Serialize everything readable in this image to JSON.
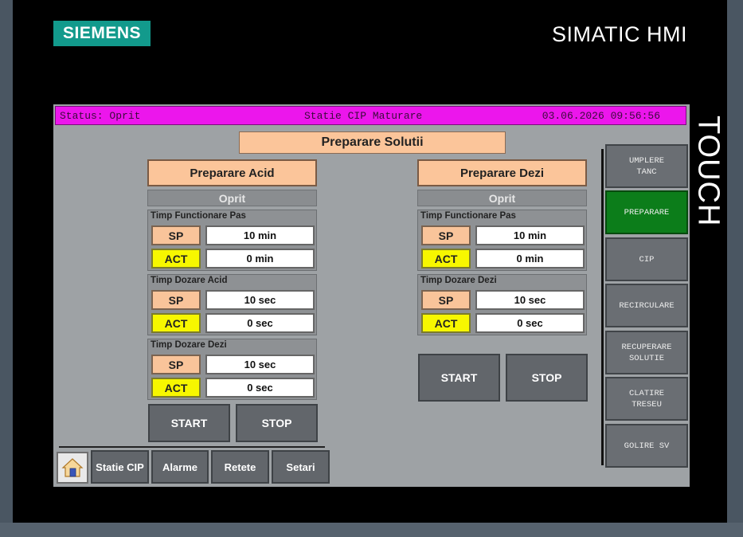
{
  "device": {
    "brand_logo": "SIEMENS",
    "model_label": "SIMATIC HMI",
    "side_label": "TOUCH"
  },
  "statusbar": {
    "status": "Status: Oprit",
    "station": "Statie CIP Maturare",
    "datetime": "03.06.2026 09:56:56"
  },
  "main_title": "Preparare Solutii",
  "acid_panel": {
    "title": "Preparare Acid",
    "state": "Oprit",
    "groups": [
      {
        "title": "Timp Functionare Pas",
        "sp_label": "SP",
        "sp_value": "10 min",
        "act_label": "ACT",
        "act_value": "0 min"
      },
      {
        "title": "Timp Dozare Acid",
        "sp_label": "SP",
        "sp_value": "10 sec",
        "act_label": "ACT",
        "act_value": "0 sec"
      },
      {
        "title": "Timp Dozare Dezi",
        "sp_label": "SP",
        "sp_value": "10 sec",
        "act_label": "ACT",
        "act_value": "0 sec"
      }
    ],
    "start_label": "START",
    "stop_label": "STOP"
  },
  "dezi_panel": {
    "title": "Preparare Dezi",
    "state": "Oprit",
    "groups": [
      {
        "title": "Timp Functionare Pas",
        "sp_label": "SP",
        "sp_value": "10 min",
        "act_label": "ACT",
        "act_value": "0 min"
      },
      {
        "title": "Timp Dozare Dezi",
        "sp_label": "SP",
        "sp_value": "10 sec",
        "act_label": "ACT",
        "act_value": "0 sec"
      }
    ],
    "start_label": "START",
    "stop_label": "STOP"
  },
  "side_menu": [
    {
      "label": "UMPLERE\nTANC",
      "active": false
    },
    {
      "label": "PREPARARE",
      "active": true
    },
    {
      "label": "CIP",
      "active": false
    },
    {
      "label": "RECIRCULARE",
      "active": false
    },
    {
      "label": "RECUPERARE\nSOLUTIE",
      "active": false
    },
    {
      "label": "CLATIRE\nTRESEU",
      "active": false
    },
    {
      "label": "GOLIRE SV",
      "active": false
    }
  ],
  "bottom_nav": {
    "home_icon": "home-icon",
    "items": [
      "Statie CIP",
      "Alarme",
      "Retete",
      "Setari"
    ]
  },
  "colors": {
    "statusbar_bg": "#ec16ec",
    "heading_bg": "#fbc59a",
    "act_bg": "#f7f700",
    "active_menu": "#0c7d1a",
    "screen_bg": "#9ea2a5"
  }
}
